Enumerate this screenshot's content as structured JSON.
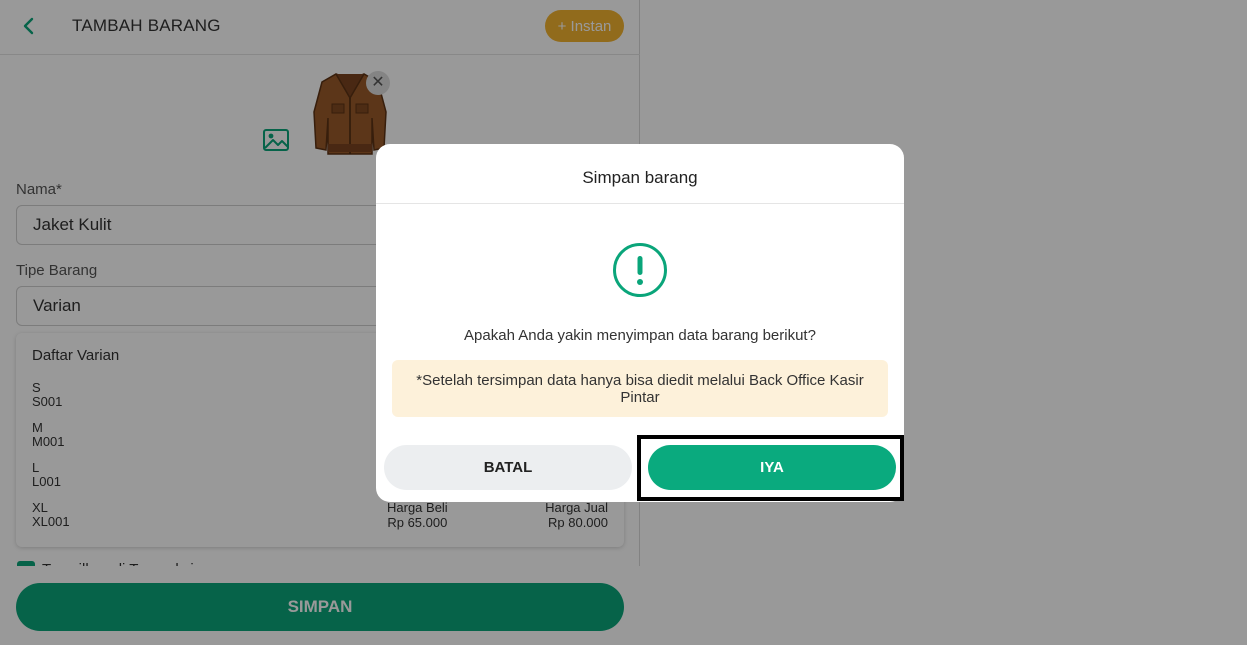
{
  "header": {
    "title": "TAMBAH BARANG",
    "instan_label": "+ Instan"
  },
  "form": {
    "name_label": "Nama*",
    "name_value": "Jaket Kulit",
    "type_label": "Tipe Barang",
    "type_value": "Varian"
  },
  "variants": {
    "title": "Daftar Varian",
    "items": [
      {
        "name": "S",
        "code": "S001"
      },
      {
        "name": "M",
        "code": "M001"
      },
      {
        "name": "L",
        "code": "L001"
      },
      {
        "name": "XL",
        "code": "XL001",
        "buy_label": "Harga Beli",
        "buy_price": "Rp 65.000",
        "sell_label": "Harga Jual",
        "sell_price": "Rp 80.000"
      }
    ]
  },
  "checkbox": {
    "label": "Tampilkan di Transaksi",
    "checked": true
  },
  "footer": {
    "save_label": "SIMPAN"
  },
  "dialog": {
    "title": "Simpan barang",
    "question": "Apakah Anda yakin menyimpan data barang berikut?",
    "note": "*Setelah tersimpan data hanya bisa diedit melalui Back Office Kasir Pintar",
    "cancel_label": "BATAL",
    "confirm_label": "IYA"
  },
  "colors": {
    "primary": "#0aa57a",
    "accent": "#f2b230",
    "note_bg": "#fdf1da",
    "overlay": "rgba(0,0,0,0.4)"
  },
  "icons": {
    "back": "chevron-left-icon",
    "image_add": "image-icon",
    "remove": "close-icon",
    "warning": "exclamation-circle-icon"
  }
}
